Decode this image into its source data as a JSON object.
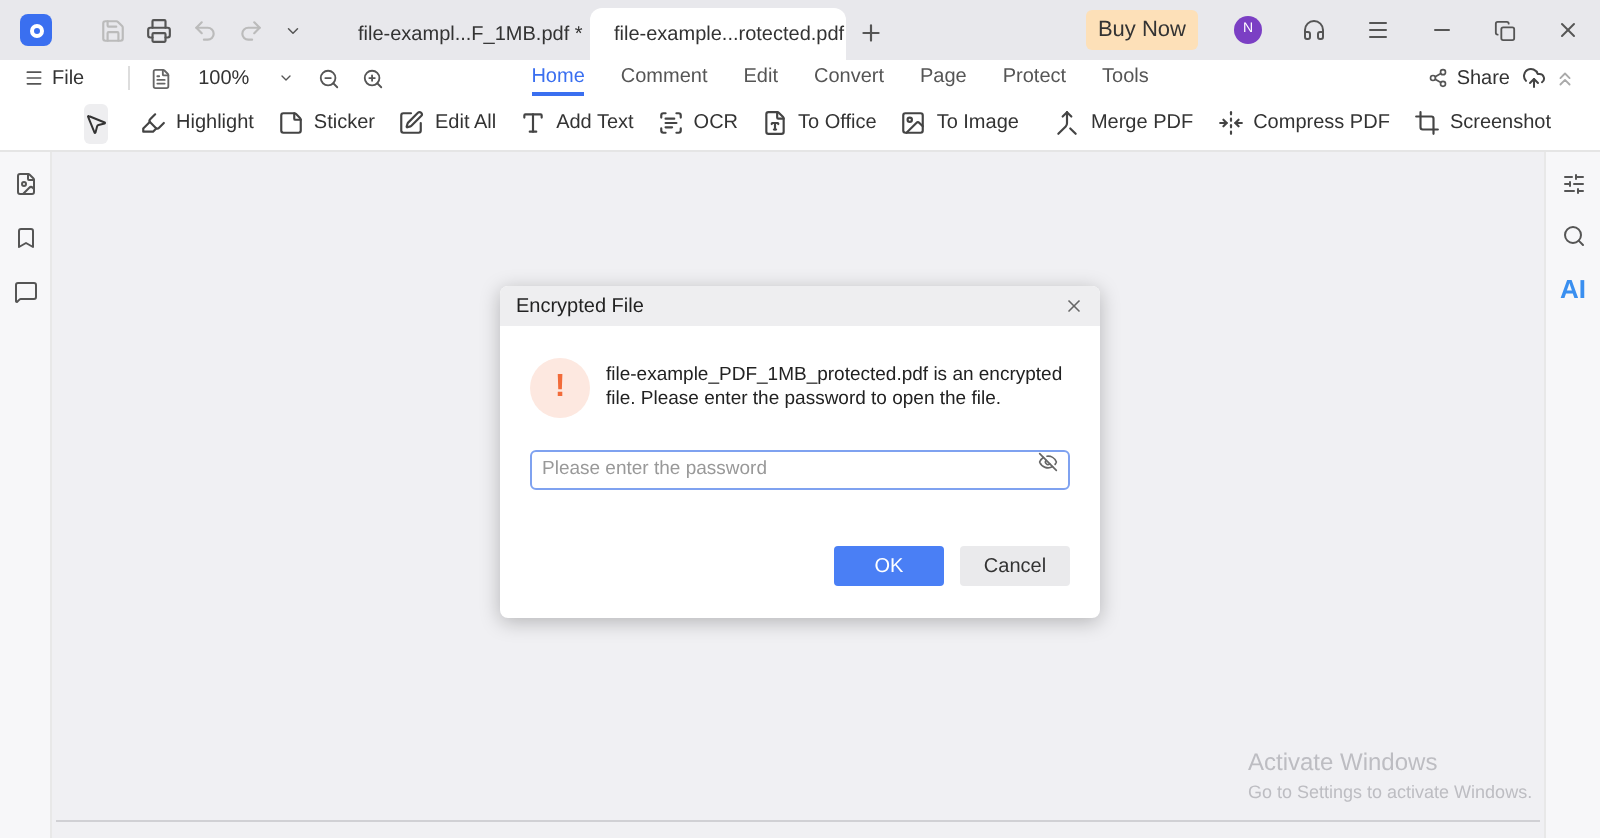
{
  "doc_tabs": [
    {
      "label": "file-exampl...F_1MB.pdf *",
      "selected": false
    },
    {
      "label": "file-example...rotected.pdf",
      "selected": true
    }
  ],
  "buy_button": "Buy Now",
  "avatar": "N",
  "menu": {
    "file": "File",
    "zoom": "100%"
  },
  "ribbon_tabs": [
    {
      "label": "Home",
      "selected": true
    },
    {
      "label": "Comment",
      "selected": false
    },
    {
      "label": "Edit",
      "selected": false
    },
    {
      "label": "Convert",
      "selected": false
    },
    {
      "label": "Page",
      "selected": false
    },
    {
      "label": "Protect",
      "selected": false
    },
    {
      "label": "Tools",
      "selected": false
    }
  ],
  "share": "Share",
  "tools": [
    {
      "kind": "highlight",
      "label": "Highlight"
    },
    {
      "kind": "sticker",
      "label": "Sticker"
    },
    {
      "kind": "edit",
      "label": "Edit All"
    },
    {
      "kind": "text",
      "label": "Add Text"
    },
    {
      "kind": "ocr",
      "label": "OCR"
    },
    {
      "kind": "office",
      "label": "To Office"
    },
    {
      "kind": "image",
      "label": "To Image"
    },
    {
      "kind": "merge",
      "label": "Merge PDF"
    },
    {
      "kind": "compress",
      "label": "Compress PDF"
    },
    {
      "kind": "screenshot",
      "label": "Screenshot"
    }
  ],
  "right_sidebar": {
    "ai": "AI"
  },
  "dialog": {
    "title": "Encrypted File",
    "icon": "!",
    "message": "file-example_PDF_1MB_protected.pdf is an encrypted file. Please enter the password to open the file.",
    "password_placeholder": "Please enter the password",
    "ok": "OK",
    "cancel": "Cancel"
  },
  "activation": {
    "title": "Activate Windows",
    "subtitle": "Go to Settings to activate Windows."
  }
}
